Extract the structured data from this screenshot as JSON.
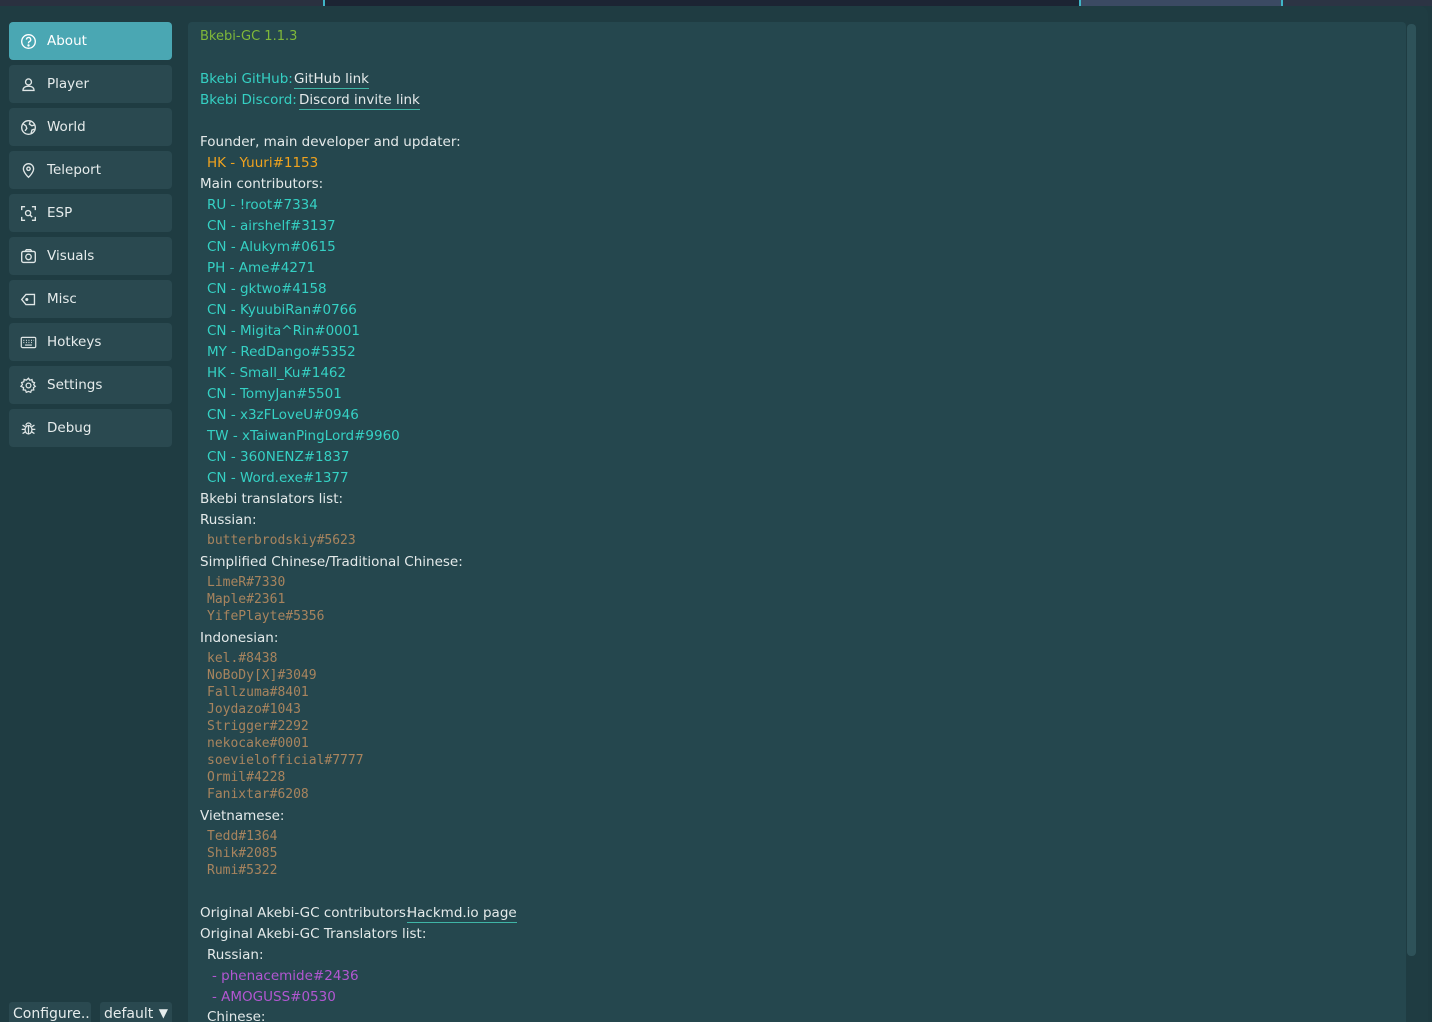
{
  "sidebar": {
    "items": [
      {
        "label": "About",
        "icon": "question-circle-icon"
      },
      {
        "label": "Player",
        "icon": "user-icon"
      },
      {
        "label": "World",
        "icon": "globe-icon"
      },
      {
        "label": "Teleport",
        "icon": "map-pin-icon"
      },
      {
        "label": "ESP",
        "icon": "scan-icon"
      },
      {
        "label": "Visuals",
        "icon": "camera-icon"
      },
      {
        "label": "Misc",
        "icon": "tag-icon"
      },
      {
        "label": "Hotkeys",
        "icon": "keyboard-icon"
      },
      {
        "label": "Settings",
        "icon": "gear-icon"
      },
      {
        "label": "Debug",
        "icon": "bug-icon"
      }
    ],
    "active": "About"
  },
  "footer": {
    "configure_label": "Configure...",
    "profile_value": "default"
  },
  "about": {
    "version": "Bkebi-GC 1.1.3",
    "github_label": "Bkebi GitHub:",
    "github_link": "GitHub link",
    "discord_label": "Bkebi Discord:",
    "discord_link": "Discord invite link",
    "founder_heading": "Founder, main developer and updater:",
    "founder": "HK - Yuuri#1153",
    "contributors_heading": "Main contributors:",
    "contributors": [
      "RU - !root#7334",
      "CN - airshelf#3137",
      "CN - Alukym#0615",
      "PH - Ame#4271",
      "CN - gktwo#4158",
      "CN - KyuubiRan#0766",
      "CN - Migita^Rin#0001",
      "MY - RedDango#5352",
      "HK - Small_Ku#1462",
      "CN - TomyJan#5501",
      "CN - x3zFLoveU#0946",
      "TW - xTaiwanPingLord#9960",
      "CN - 360NENZ#1837",
      "CN - Word.exe#1377"
    ],
    "translators_heading": "Bkebi translators list:",
    "russian_heading": "Russian:",
    "russian": [
      "butterbrodskiy#5623"
    ],
    "chinese_heading": "Simplified Chinese/Traditional Chinese:",
    "chinese": [
      "LimeR#7330",
      "Maple#2361",
      "YifePlayte#5356"
    ],
    "indonesian_heading": "Indonesian:",
    "indonesian": [
      "kel.#8438",
      "NoBoDy[X]#3049",
      "Fallzuma#8401",
      "Joydazo#1043",
      "Strigger#2292",
      "nekocake#0001",
      "soevielofficial#7777",
      "Ormil#4228",
      "Fanixtar#6208"
    ],
    "vietnamese_heading": "Vietnamese:",
    "vietnamese": [
      "Tedd#1364",
      "Shik#2085",
      "Rumi#5322"
    ],
    "akebi_contrib_label": "Original Akebi-GC contributors:",
    "akebi_contrib_link": "Hackmd.io page",
    "akebi_translators_heading": "Original Akebi-GC Translators list:",
    "akebi_russian_heading": "Russian:",
    "akebi_russian": [
      "- phenacemide#2436",
      "- AMOGUSS#0530"
    ],
    "akebi_chinese_heading": "Chinese:"
  },
  "colors": {
    "accent": "#4aa7b3",
    "version": "#7fb83a",
    "contributor": "#35d1c4",
    "founder": "#f0a31e",
    "translator": "#a8845e",
    "akebi_translator": "#b257d2"
  }
}
